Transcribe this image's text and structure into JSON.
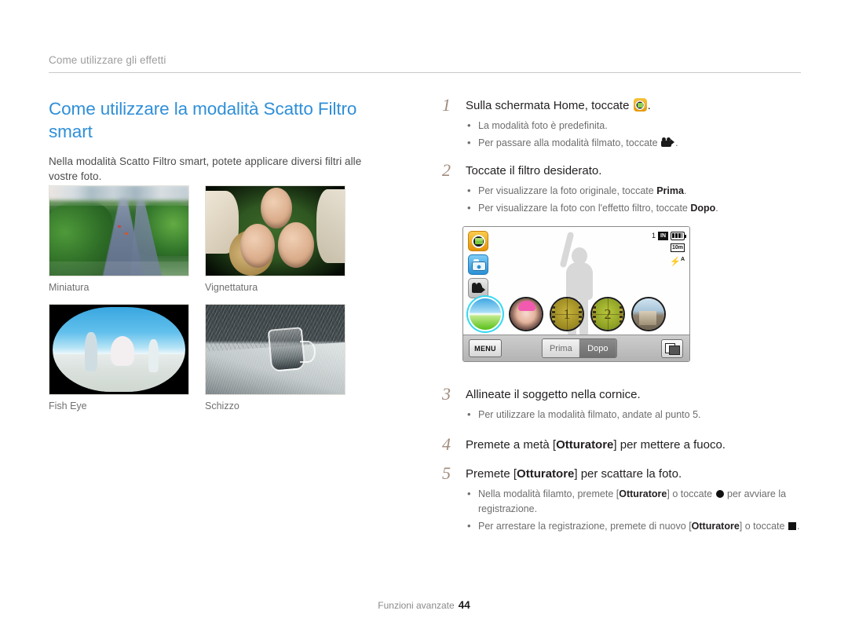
{
  "document": {
    "running_head": "Come utilizzare gli effetti",
    "footer": {
      "section": "Funzioni avanzate",
      "page_number": "44"
    }
  },
  "colors": {
    "heading": "#2f8fd8",
    "step_number": "#a08b7d",
    "body_text": "#4d4d4d",
    "muted_text": "#6d6d6d",
    "rule": "#c9c9c9"
  },
  "left_column": {
    "title": "Come utilizzare la modalità Scatto Filtro smart",
    "intro": "Nella modalità Scatto Filtro smart, potete applicare diversi filtri alle vostre foto.",
    "samples": [
      {
        "caption": "Miniatura",
        "icon": "miniature-photo"
      },
      {
        "caption": "Vignettatura",
        "icon": "vignette-photo"
      },
      {
        "caption": "Fish Eye",
        "icon": "fisheye-photo"
      },
      {
        "caption": "Schizzo",
        "icon": "sketch-photo"
      }
    ]
  },
  "right_column": {
    "steps": [
      {
        "number": "1",
        "head_before": "Sulla schermata Home, toccate",
        "head_icon": "smart-filter-icon",
        "head_after": ".",
        "bullets": [
          {
            "text_before": "La modalità foto è predefinita.",
            "icon": "",
            "text_after": ""
          },
          {
            "text_before": "Per passare alla modalità filmato, toccate",
            "icon": "video-camera-icon",
            "text_after": "."
          }
        ]
      },
      {
        "number": "2",
        "head_before": "Toccate il filtro desiderato.",
        "head_icon": "",
        "head_after": "",
        "bullets": [
          {
            "text_before": "Per visualizzare la foto originale, toccate",
            "bold": "Prima",
            "text_after": "."
          },
          {
            "text_before": "Per visualizzare la foto con l'effetto filtro, toccate",
            "bold": "Dopo",
            "text_after": "."
          }
        ]
      },
      {
        "number": "3",
        "head_before": "Allineate il soggetto nella cornice.",
        "head_icon": "",
        "head_after": "",
        "bullets": [
          {
            "text_before": "Per utilizzare la modalità filmato, andate al punto 5.",
            "bold": "",
            "text_after": ""
          }
        ]
      },
      {
        "number": "4",
        "head_before": "Premete a metà [",
        "bold": "Otturatore",
        "head_after": "] per mettere a fuoco.",
        "bullets": []
      },
      {
        "number": "5",
        "head_before": "Premete [",
        "bold": "Otturatore",
        "head_after": "] per scattare la foto.",
        "bullets": [
          {
            "p1": "Nella modalità filamto, premete [",
            "b1": "Otturatore",
            "p2": "] o toccate",
            "icon": "record-circle-icon",
            "p3": "per avviare la registrazione."
          },
          {
            "p1": "Per arrestare la registrazione, premete di nuovo [",
            "b1": "Otturatore",
            "p2": "] o toccate",
            "icon": "stop-square-icon",
            "p3": "."
          }
        ]
      }
    ]
  },
  "camera_screen": {
    "mode_buttons": [
      {
        "name": "smart-filter-mode",
        "label": ""
      },
      {
        "name": "photo-mode",
        "label": ""
      },
      {
        "name": "movie-mode",
        "label": ""
      }
    ],
    "status": {
      "shots_remaining": "1",
      "memory_badge": "IN",
      "battery": "full",
      "resolution_badge": "10m",
      "flash_mode": "A"
    },
    "filter_thumbnails": [
      {
        "name": "filter-normal",
        "label": ""
      },
      {
        "name": "filter-vignette",
        "label": ""
      },
      {
        "name": "filter-movie-1",
        "label": "1"
      },
      {
        "name": "filter-movie-2",
        "label": "2"
      },
      {
        "name": "filter-classic",
        "label": ""
      }
    ],
    "toolbar": {
      "menu_label": "MENU",
      "before_label": "Prima",
      "after_label": "Dopo",
      "share_icon": "share-icon"
    }
  }
}
